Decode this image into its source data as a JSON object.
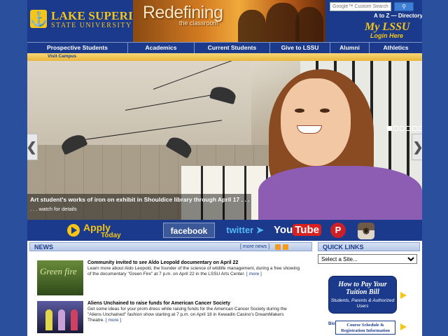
{
  "header": {
    "logo_line1": "LAKE SUPERIOR",
    "logo_line2": "STATE UNIVERSITY",
    "logo_mark": "⚓",
    "banner_title": "Redefining",
    "banner_subtitle": "the classroom",
    "search_placeholder": "Google™ Custom Search",
    "search_button": "search",
    "link_atoz": "A to Z",
    "link_sep": "—",
    "link_directory": "Directory",
    "mylssu": "My LSSU",
    "login": "Login Here"
  },
  "nav": {
    "items": [
      "Prospective Students",
      "Academics",
      "Current Students",
      "Give to LSSU",
      "Alumni",
      "Athletics"
    ]
  },
  "subnav": {
    "visit": "Visit Campus"
  },
  "hero": {
    "caption_title": "Art student's works of iron on exhibit in Shouldice library through April 17 . . .",
    "caption_more": ". . . watch for details",
    "prev": "❮",
    "next": "❯",
    "slide_count": 8,
    "active_slide": 1
  },
  "social": {
    "apply_line1": "Apply",
    "apply_line2": "Today",
    "facebook": "facebook",
    "twitter": "twitter",
    "youtube_you": "You",
    "youtube_tube": "Tube",
    "pinterest": "P",
    "instagram": "◉"
  },
  "news": {
    "title": "NEWS",
    "more": "[ more news ]",
    "items": [
      {
        "title": "Community invited to see Aldo Leopold documentary on April 22",
        "body": "Learn more about Aldo Leopold, the founder of the science of wildlife management, during a free showing of the documentary \"Green Fire\" at 7 p.m. on April 22 in the LSSU Arts Center.",
        "more": "[ more ]",
        "thumb_text": "Green fire"
      },
      {
        "title": "Aliens Unchained to raise funds for American Cancer Society",
        "body": "Get some ideas for your prom dress while raising funds for the American Cancer Society during the \"Aliens Unchained\" fashion show starting at 7 p.m. on April 18 in Kewadin Casino's DreamMakers Theatre.",
        "more": "[ more ]"
      }
    ]
  },
  "quick_links": {
    "title": "QUICK LINKS",
    "select_value": "Select a Site...",
    "tuition_title": "How to Pay Your Tuition Bill",
    "tuition_sub": "Students, Parents & Authorized Users",
    "schedule": "Course Schedule & Registration Information",
    "side_text": "Bio Typ"
  },
  "colors": {
    "brand_blue": "#1b3a8c",
    "brand_gold": "#f5c518",
    "page_background": "#2a4f9c"
  }
}
